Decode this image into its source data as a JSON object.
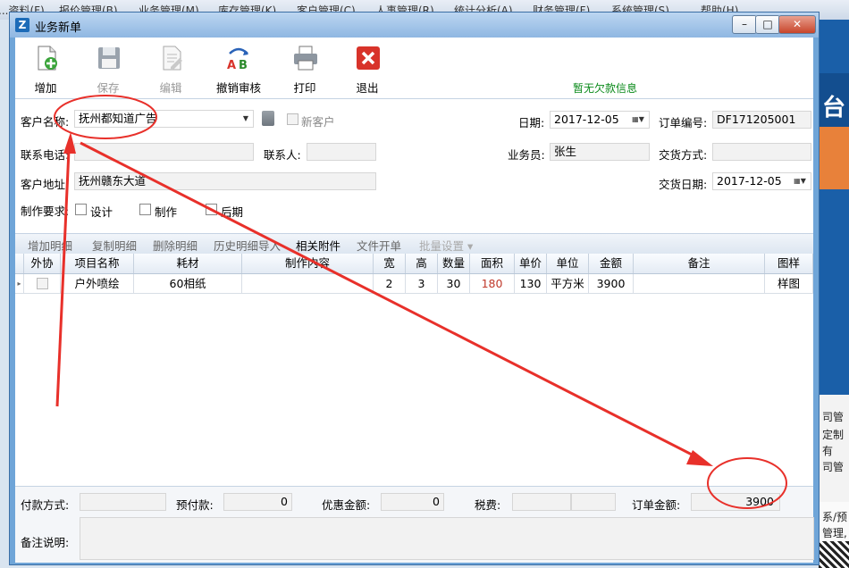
{
  "background_app": {
    "menu": [
      "...资料(F)",
      "报价管理(B)",
      "业务管理(M)",
      "库存管理(K)",
      "客户管理(C)",
      "人事管理(R)",
      "统计分析(A)",
      "财务管理(F)",
      "系统管理(S)",
      "帮助(H)"
    ],
    "side_text": [
      "台",
      "司管",
      "定制",
      "有",
      "司管",
      "系/预",
      "管理,"
    ]
  },
  "window": {
    "title": "业务新单",
    "controls": {
      "minimize": "–",
      "maximize": "□",
      "close": "✕"
    }
  },
  "toolbar": {
    "buttons": [
      {
        "label": "增加",
        "icon": "add-document-icon",
        "enabled": true
      },
      {
        "label": "保存",
        "icon": "floppy-disk-icon",
        "enabled": false
      },
      {
        "label": "编辑",
        "icon": "edit-document-icon",
        "enabled": false
      },
      {
        "label": "撤销审核",
        "icon": "undo-ab-icon",
        "enabled": true
      },
      {
        "label": "打印",
        "icon": "printer-icon",
        "enabled": true
      },
      {
        "label": "退出",
        "icon": "exit-x-icon",
        "enabled": true
      }
    ],
    "debt_message": "暂无欠款信息"
  },
  "form": {
    "customer_name_label": "客户名称:",
    "customer_name_value": "抚州都知道广告",
    "new_customer_label": "新客户",
    "date_label": "日期:",
    "date_value": "2017-12-05",
    "order_no_label": "订单编号:",
    "order_no_value": "DF171205001",
    "phone_label": "联系电话:",
    "phone_value": "",
    "contact_label": "联系人:",
    "contact_value": "",
    "salesman_label": "业务员:",
    "salesman_value": "张生",
    "delivery_method_label": "交货方式:",
    "delivery_method_value": "",
    "address_label": "客户地址:",
    "address_value": "抚州赣东大道",
    "delivery_date_label": "交货日期:",
    "delivery_date_value": "2017-12-05",
    "requirements_label": "制作要求:",
    "requirements": [
      "设计",
      "制作",
      "后期"
    ]
  },
  "detail_toolbar": [
    "增加明细",
    "复制明细",
    "删除明细",
    "历史明细导入",
    "相关附件",
    "文件开单",
    "批量设置 ▾"
  ],
  "grid": {
    "columns": [
      "外协",
      "项目名称",
      "耗材",
      "制作内容",
      "宽",
      "高",
      "数量",
      "面积",
      "单价",
      "单位",
      "金额",
      "备注",
      "图样"
    ],
    "rows": [
      [
        "",
        "户外喷绘",
        "60相纸",
        "",
        "2",
        "3",
        "30",
        "180",
        "130",
        "平方米",
        "3900",
        "",
        "样图"
      ]
    ]
  },
  "footer": {
    "payment_method_label": "付款方式:",
    "payment_method_value": "",
    "prepaid_label": "预付款:",
    "prepaid_value": "0",
    "discount_label": "优惠金额:",
    "discount_value": "0",
    "tax_label": "税费:",
    "tax_value": "",
    "order_amount_label": "订单金额:",
    "order_amount_value": "3900",
    "remarks_label": "备注说明:",
    "remarks_value": ""
  },
  "colors": {
    "annotation": "#e8302a",
    "window_frame": "#6fa5d8",
    "debt_message": "#0a8a1a",
    "area_value": "#c0392b"
  }
}
